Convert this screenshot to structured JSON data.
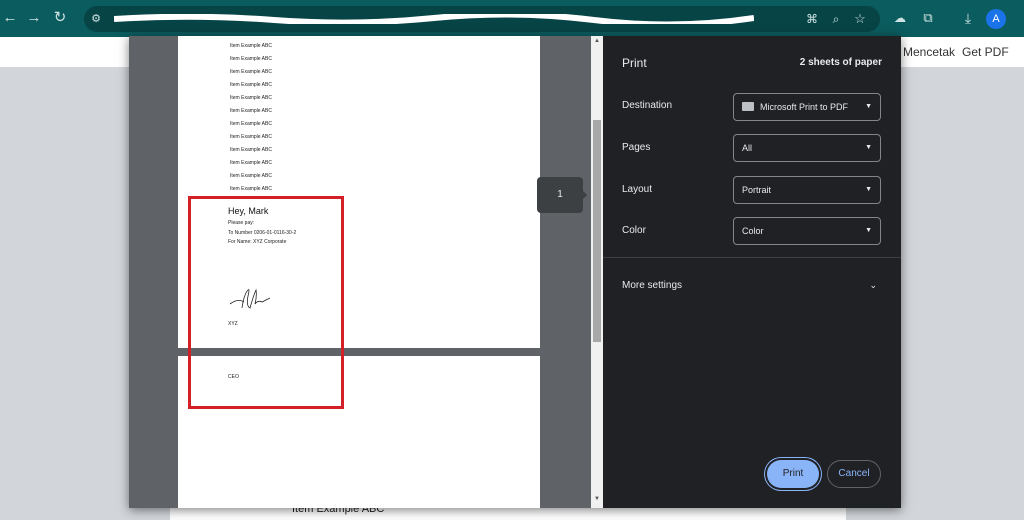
{
  "browser": {
    "avatar_letter": "A",
    "icons": [
      "back-icon",
      "forward-icon",
      "reload-icon",
      "site-info-icon",
      "translate-icon",
      "zoom-icon",
      "bookmark-star-icon",
      "cloud-icon",
      "extensions-icon",
      "download-icon"
    ]
  },
  "page": {
    "links": [
      "Mencetak",
      "Get PDF"
    ],
    "behind_text": "Item Example ABC"
  },
  "preview": {
    "items": [
      "Item Example ABC",
      "Item Example ABC",
      "Item Example ABC",
      "Item Example ABC",
      "Item Example ABC",
      "Item Example ABC",
      "Item Example ABC",
      "Item Example ABC",
      "Item Example ABC",
      "Item Example ABC",
      "Item Example ABC",
      "Item Example ABC"
    ],
    "greeting": "Hey, Mark",
    "please_pay": "Please pay:",
    "to_number": "To Number 0206-01-0116-30-2",
    "for_name": "For Name: XYZ Corporate",
    "company": "XYZ",
    "role": "CEO",
    "page_badge": "1"
  },
  "print_panel": {
    "title": "Print",
    "sheets": "2 sheets of paper",
    "destination_label": "Destination",
    "destination_value": "Microsoft Print to PDF",
    "pages_label": "Pages",
    "pages_value": "All",
    "layout_label": "Layout",
    "layout_value": "Portrait",
    "color_label": "Color",
    "color_value": "Color",
    "more_settings": "More settings",
    "print_button": "Print",
    "cancel_button": "Cancel"
  },
  "colors": {
    "toolbar": "#0b5c5e",
    "dialog_bg": "#202124",
    "accent": "#8ab4f8",
    "highlight": "#d32027"
  }
}
